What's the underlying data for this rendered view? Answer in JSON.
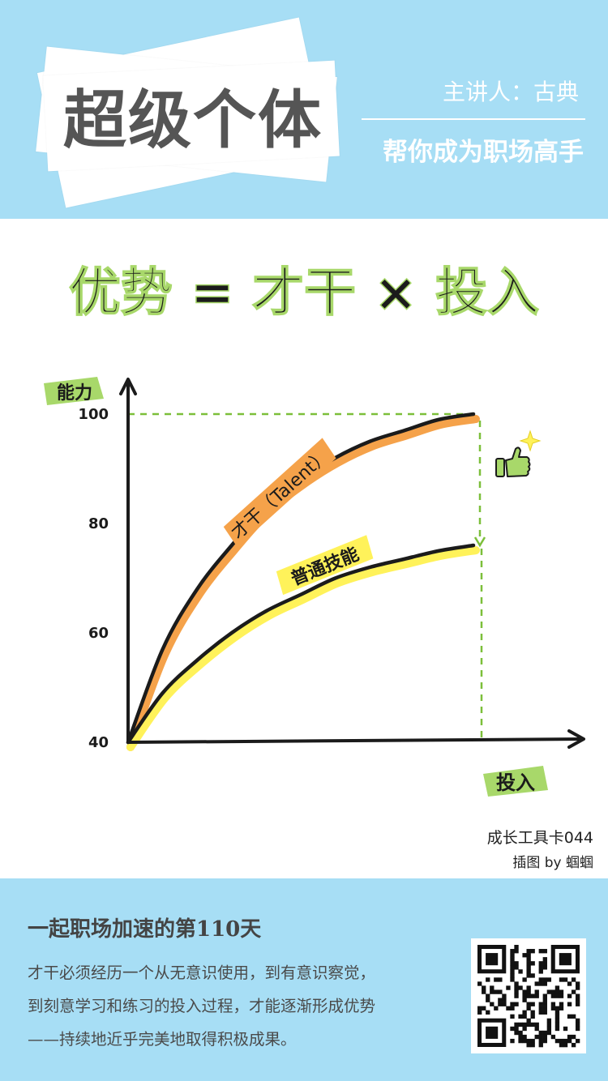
{
  "header": {
    "title": "超级个体",
    "speaker": "主讲人：古典",
    "subtitle": "帮你成为职场高手"
  },
  "chart_data": {
    "type": "line",
    "title": "优势 = 才干 × 投入",
    "xlabel": "投入",
    "ylabel": "能力",
    "y_ticks": [
      "100",
      "80",
      "60",
      "40"
    ],
    "ylim": [
      40,
      100
    ],
    "x": [
      0,
      0.1,
      0.2,
      0.3,
      0.4,
      0.5,
      0.6,
      0.7,
      0.8,
      0.9,
      1.0
    ],
    "series": [
      {
        "name": "才干（Talent）",
        "values": [
          40,
          57,
          68,
          76,
          83,
          88,
          92,
          95,
          97,
          99,
          100
        ]
      },
      {
        "name": "普通技能",
        "values": [
          40,
          49,
          55,
          60,
          64,
          67,
          70,
          72,
          73.5,
          75,
          76
        ]
      }
    ],
    "annotations": [
      "成长工具卡044",
      "插图 by 蝈蝈"
    ],
    "colors": {
      "talent": "#f5a24a",
      "skill": "#fff25a",
      "label_bg": "#a8d86a",
      "ink": "#1b1b1b",
      "guide": "#7cbf3a"
    },
    "icons": [
      "thumbs-up-icon",
      "sparkle-icon"
    ]
  },
  "footer": {
    "title": "一起职场加速的第110天",
    "body": [
      "才干必须经历一个从无意识使用，到有意识察觉，",
      "到刻意学习和练习的投入过程，才能逐渐形成优势",
      "——持续地近乎完美地取得积极成果。"
    ]
  }
}
